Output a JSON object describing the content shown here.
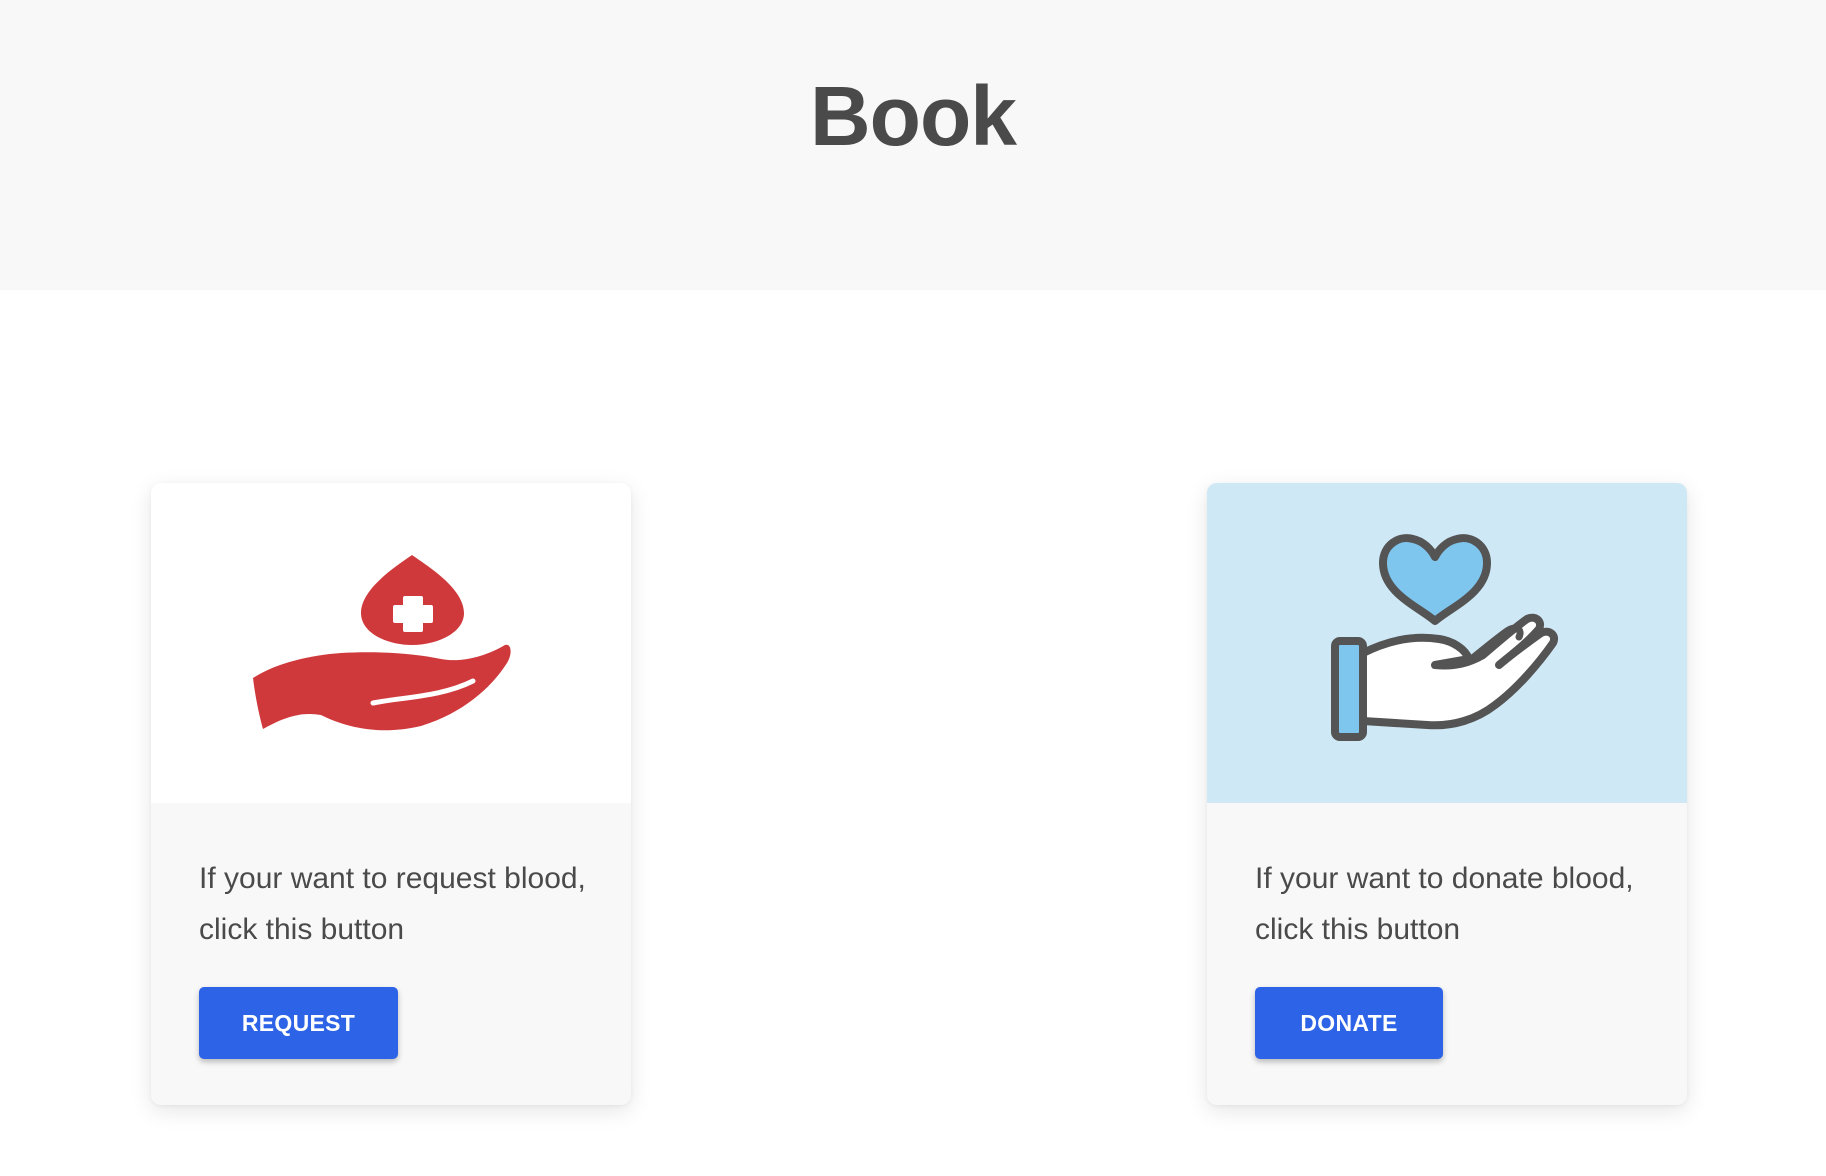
{
  "header": {
    "title": "Book"
  },
  "cards": [
    {
      "icon": "hand-blood-drop-icon",
      "text": "If your want to request blood, click this button",
      "button_label": "REQUEST"
    },
    {
      "icon": "hand-heart-icon",
      "text": "If your want to donate blood, click this button",
      "button_label": "DONATE"
    }
  ],
  "colors": {
    "accent": "#2d63e6",
    "header_bg": "#f8f8f8",
    "request_icon": "#d0393b",
    "donate_bg": "#cfe8f6",
    "donate_heart": "#7fc6ef"
  }
}
